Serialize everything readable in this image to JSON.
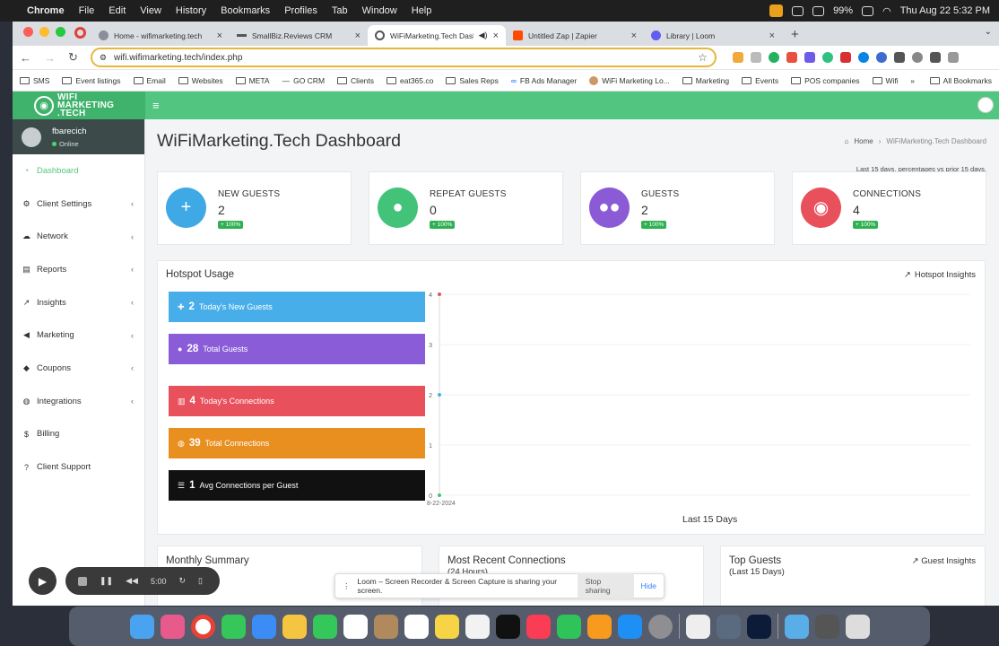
{
  "menubar": {
    "app": "Chrome",
    "items": [
      "File",
      "Edit",
      "View",
      "History",
      "Bookmarks",
      "Profiles",
      "Tab",
      "Window",
      "Help"
    ],
    "battery": "99%",
    "clock": "Thu Aug 22  5:32 PM"
  },
  "tabs": [
    {
      "title": "Home - wifimarketing.tech",
      "color": "#8a8f99"
    },
    {
      "title": "SmallBiz.Reviews CRM",
      "color": "#555"
    },
    {
      "title": "WiFiMarketing.Tech Dashb",
      "color": "#ddd"
    },
    {
      "title": "Untitled Zap | Zapier",
      "color": "#ff4a00"
    },
    {
      "title": "Library | Loom",
      "color": "#625df5"
    }
  ],
  "url": "wifi.wifimarketing.tech/index.php",
  "bookmarks": [
    "SMS",
    "Event listings",
    "Email",
    "Websites",
    "META",
    "GO CRM",
    "Clients",
    "eat365.co",
    "Sales Reps",
    "FB Ads Manager",
    "WiFi Marketing Lo...",
    "Marketing",
    "Events",
    "POS companies",
    "Wifi"
  ],
  "bookmarks_all": "All Bookmarks",
  "user": {
    "name": "fbarecich",
    "status": "Online"
  },
  "nav": [
    {
      "label": "Dashboard",
      "icon": "dashboard-icon",
      "chevron": ""
    },
    {
      "label": "Client Settings",
      "icon": "gear-icon",
      "chevron": "‹"
    },
    {
      "label": "Network",
      "icon": "cloud-icon",
      "chevron": "‹"
    },
    {
      "label": "Reports",
      "icon": "file-icon",
      "chevron": "‹"
    },
    {
      "label": "Insights",
      "icon": "chart-icon",
      "chevron": "‹"
    },
    {
      "label": "Marketing",
      "icon": "megaphone-icon",
      "chevron": "‹"
    },
    {
      "label": "Coupons",
      "icon": "tag-icon",
      "chevron": "‹"
    },
    {
      "label": "Integrations",
      "icon": "globe-icon",
      "chevron": "‹"
    },
    {
      "label": "Billing",
      "icon": "dollar-icon",
      "chevron": ""
    },
    {
      "label": "Client Support",
      "icon": "help-icon",
      "chevron": ""
    }
  ],
  "page": {
    "title": "WiFiMarketing.Tech Dashboard",
    "crumb_home": "Home",
    "crumb_current": "WiFiMarketing.Tech Dashboard",
    "note": "Last 15 days, percentages vs prior 15 days."
  },
  "stats": [
    {
      "label": "NEW GUESTS",
      "value": "2",
      "badge": "+ 100%",
      "color": "#3fa9e6",
      "icon": "plus-icon"
    },
    {
      "label": "REPEAT GUESTS",
      "value": "0",
      "badge": "+ 100%",
      "color": "#43c27a",
      "icon": "user-icon"
    },
    {
      "label": "GUESTS",
      "value": "2",
      "badge": "+ 100%",
      "color": "#8b5bd6",
      "icon": "users-icon"
    },
    {
      "label": "CONNECTIONS",
      "value": "4",
      "badge": "+ 100%",
      "color": "#e8505b",
      "icon": "globe-icon"
    }
  ],
  "hotspot": {
    "title": "Hotspot Usage",
    "link": "Hotspot Insights",
    "bars": [
      {
        "num": "2",
        "label": "Today's New Guests",
        "color": "#47aeea"
      },
      {
        "num": "28",
        "label": "Total Guests",
        "color": "#8a5cd8"
      },
      {
        "num": "4",
        "label": "Today's Connections",
        "color": "#e8505b"
      },
      {
        "num": "39",
        "label": "Total Connections",
        "color": "#e88f20"
      },
      {
        "num": "1",
        "label": "Avg Connections per Guest",
        "color": "#111111"
      }
    ],
    "caption": "Last 15 Days"
  },
  "chart_data": {
    "type": "line",
    "x": [
      "08-22-2024"
    ],
    "ylim": [
      0,
      4
    ],
    "yticks": [
      "0",
      "1",
      "2",
      "3",
      "4"
    ],
    "series": [
      {
        "values": [
          4
        ],
        "color": "#e8505b"
      },
      {
        "values": [
          2
        ],
        "color": "#47aeea"
      },
      {
        "values": [
          0
        ],
        "color": "#43c27a"
      }
    ]
  },
  "cards": [
    {
      "title": "Monthly Summary",
      "sub": "",
      "link": ""
    },
    {
      "title": "Most Recent Connections",
      "sub": "(24 Hours)",
      "link": ""
    },
    {
      "title": "Top Guests",
      "sub": "(Last 15 Days)",
      "link": "Guest Insights"
    }
  ],
  "loom": {
    "message": "Loom – Screen Recorder & Screen Capture is sharing your screen.",
    "stop": "Stop sharing",
    "hide": "Hide",
    "timer": "5:00"
  }
}
